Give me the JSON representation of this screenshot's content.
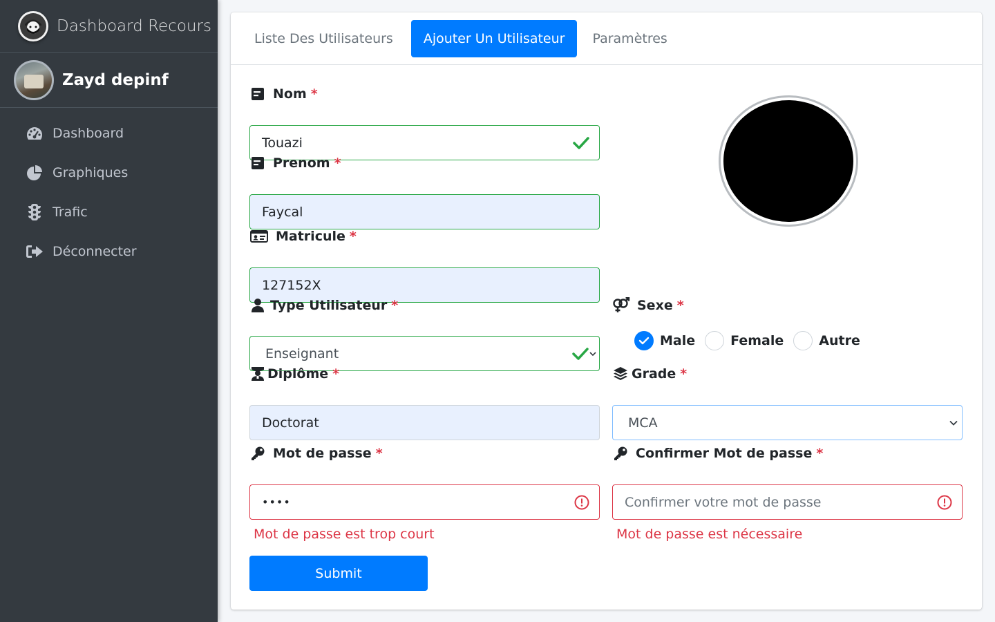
{
  "brand": {
    "title": "Dashboard Recours",
    "logo_icon": "masked-face-icon"
  },
  "user": {
    "name": "Zayd depinf"
  },
  "sidebar": {
    "items": [
      {
        "label": "Dashboard",
        "icon": "tachometer-icon"
      },
      {
        "label": "Graphiques",
        "icon": "pie-chart-icon"
      },
      {
        "label": "Trafic",
        "icon": "traffic-light-icon"
      },
      {
        "label": "Déconnecter",
        "icon": "sign-out-icon"
      }
    ]
  },
  "tabs": [
    {
      "label": "Liste Des Utilisateurs",
      "active": false
    },
    {
      "label": "Ajouter Un Utilisateur",
      "active": true
    },
    {
      "label": "Paramètres",
      "active": false
    }
  ],
  "form": {
    "required_mark": "*",
    "nom": {
      "label": "Nom",
      "value": "Touazi",
      "state": "valid"
    },
    "prenom": {
      "label": "Prenom",
      "value": "Faycal",
      "state": "valid"
    },
    "matricule": {
      "label": "Matricule",
      "value": "127152X",
      "state": "valid"
    },
    "type_utilisateur": {
      "label": "Type Utilisateur",
      "value": "Enseignant",
      "state": "valid"
    },
    "sexe": {
      "label": "Sexe",
      "options": [
        "Male",
        "Female",
        "Autre"
      ],
      "selected": "Male"
    },
    "diplome": {
      "label": "Diplôme",
      "value": "Doctorat"
    },
    "grade": {
      "label": "Grade",
      "value": "MCA"
    },
    "mot_de_passe": {
      "label": "Mot de passe",
      "value": "••••",
      "error": "Mot de passe est trop court"
    },
    "confirmer": {
      "label": "Confirmer Mot de passe",
      "placeholder": "Confirmer votre mot de passe",
      "error": "Mot de passe est nécessaire"
    },
    "submit_label": "Submit"
  },
  "colors": {
    "primary": "#007bff",
    "valid": "#28a745",
    "invalid": "#dc3545",
    "sidebar_bg": "#343a40"
  }
}
